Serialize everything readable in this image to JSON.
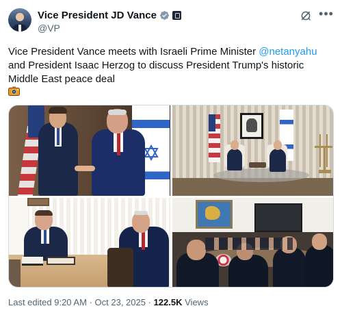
{
  "profile": {
    "display_name": "Vice President JD Vance",
    "handle": "@VP"
  },
  "post": {
    "text_before": "Vice President Vance meets with Israeli Prime Minister ",
    "mention": "@netanyahu",
    "text_after": " and President Isaac Herzog to discuss President Trump's historic Middle East peace deal",
    "emoji_icon": "camera-flash-icon"
  },
  "footer": {
    "edited_label": "Last edited",
    "time": "9:20 AM",
    "separator": "·",
    "date": "Oct 23, 2025",
    "views_count": "122.5K",
    "views_label": "Views"
  },
  "colors": {
    "accent": "#1d9bf0",
    "text": "#0f1419",
    "muted": "#536471",
    "verified": "#829aab"
  },
  "icons": [
    "verified-badge-icon",
    "government-badge-icon",
    "grok-icon",
    "more-options-icon",
    "camera-flash-icon"
  ]
}
